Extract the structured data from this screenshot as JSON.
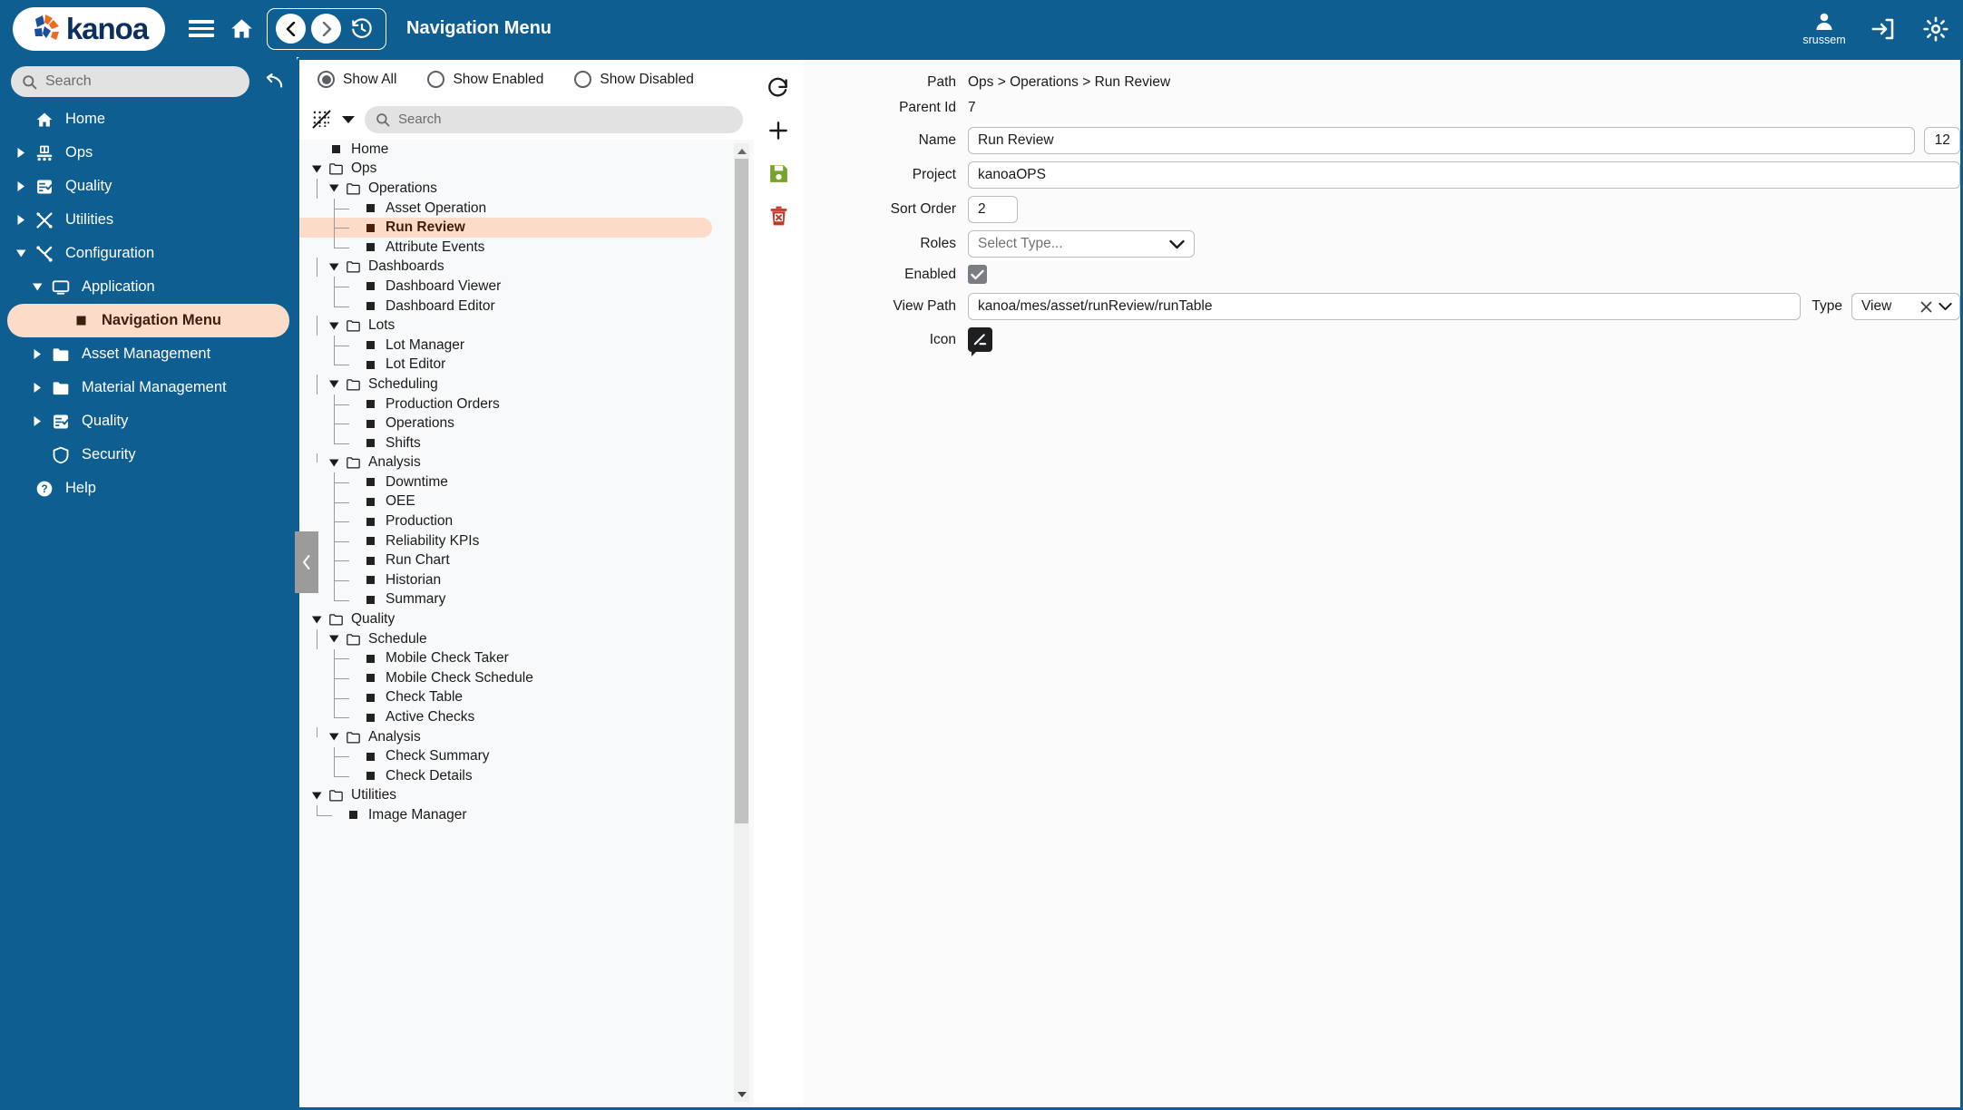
{
  "topbar": {
    "brand": "kanoa",
    "page_title": "Navigation Menu",
    "menu_icon": "hamburger-icon",
    "home_icon": "home-icon",
    "back_icon": "chevron-left-icon",
    "forward_icon": "chevron-right-icon",
    "history_icon": "history-clock-icon",
    "user_icon": "user-avatar-icon",
    "user_name": "srussem",
    "logout_icon": "logout-icon",
    "settings_icon": "gear-icon",
    "background_color": "#0e5e92"
  },
  "sidebar": {
    "search_placeholder": "Search",
    "search_icon": "search-icon",
    "undo_icon": "undo-arrow-icon",
    "items": [
      {
        "label": "Home",
        "icon": "home-icon",
        "caret": "none",
        "indent": 0,
        "selected": false
      },
      {
        "label": "Ops",
        "icon": "conveyor-icon",
        "caret": "right",
        "indent": 0,
        "selected": false
      },
      {
        "label": "Quality",
        "icon": "checklist-icon",
        "caret": "right",
        "indent": 0,
        "selected": false
      },
      {
        "label": "Utilities",
        "icon": "tools-icon",
        "caret": "right",
        "indent": 0,
        "selected": false
      },
      {
        "label": "Configuration",
        "icon": "wrench-icon",
        "caret": "down",
        "indent": 0,
        "selected": false
      },
      {
        "label": "Application",
        "icon": "monitor-icon",
        "caret": "down",
        "indent": 1,
        "selected": false
      },
      {
        "label": "Navigation Menu",
        "icon": "square-icon",
        "caret": "none",
        "indent": 2,
        "selected": true
      },
      {
        "label": "Asset Management",
        "icon": "folder-icon",
        "caret": "right",
        "indent": 1,
        "selected": false
      },
      {
        "label": "Material Management",
        "icon": "folder-icon",
        "caret": "right",
        "indent": 1,
        "selected": false
      },
      {
        "label": "Quality",
        "icon": "checklist-icon",
        "caret": "right",
        "indent": 1,
        "selected": false
      },
      {
        "label": "Security",
        "icon": "shield-icon",
        "caret": "none",
        "indent": 1,
        "selected": false
      },
      {
        "label": "Help",
        "icon": "help-circle-icon",
        "caret": "none",
        "indent": 0,
        "selected": false
      }
    ],
    "selected_bg": "#fcdcc8",
    "selected_fg": "#3d1f12"
  },
  "tree_panel": {
    "filters": [
      {
        "label": "Show All",
        "checked": true
      },
      {
        "label": "Show Enabled",
        "checked": false
      },
      {
        "label": "Show Disabled",
        "checked": false
      }
    ],
    "collapse_icon": "collapse-all-icon",
    "dropdown_icon": "chevron-down-icon",
    "search_placeholder": "Search",
    "search_icon": "search-icon",
    "collapse_handle_icon": "chevron-left-icon",
    "scroll_up_icon": "triangle-up-icon",
    "scroll_down_icon": "triangle-down-icon",
    "nodes": [
      {
        "label": "Home",
        "depth": 0,
        "type": "leaf",
        "caret": "none",
        "selected": false
      },
      {
        "label": "Ops",
        "depth": 0,
        "type": "folder",
        "caret": "down",
        "selected": false
      },
      {
        "label": "Operations",
        "depth": 1,
        "type": "folder",
        "caret": "down",
        "selected": false
      },
      {
        "label": "Asset Operation",
        "depth": 2,
        "type": "leaf",
        "caret": "none",
        "selected": false
      },
      {
        "label": "Run Review",
        "depth": 2,
        "type": "leaf",
        "caret": "none",
        "selected": true
      },
      {
        "label": "Attribute Events",
        "depth": 2,
        "type": "leaf",
        "caret": "none",
        "selected": false
      },
      {
        "label": "Dashboards",
        "depth": 1,
        "type": "folder",
        "caret": "down",
        "selected": false
      },
      {
        "label": "Dashboard Viewer",
        "depth": 2,
        "type": "leaf",
        "caret": "none",
        "selected": false
      },
      {
        "label": "Dashboard Editor",
        "depth": 2,
        "type": "leaf",
        "caret": "none",
        "selected": false
      },
      {
        "label": "Lots",
        "depth": 1,
        "type": "folder",
        "caret": "down",
        "selected": false
      },
      {
        "label": "Lot Manager",
        "depth": 2,
        "type": "leaf",
        "caret": "none",
        "selected": false
      },
      {
        "label": "Lot Editor",
        "depth": 2,
        "type": "leaf",
        "caret": "none",
        "selected": false
      },
      {
        "label": "Scheduling",
        "depth": 1,
        "type": "folder",
        "caret": "down",
        "selected": false
      },
      {
        "label": "Production Orders",
        "depth": 2,
        "type": "leaf",
        "caret": "none",
        "selected": false
      },
      {
        "label": "Operations",
        "depth": 2,
        "type": "leaf",
        "caret": "none",
        "selected": false
      },
      {
        "label": "Shifts",
        "depth": 2,
        "type": "leaf",
        "caret": "none",
        "selected": false
      },
      {
        "label": "Analysis",
        "depth": 1,
        "type": "folder",
        "caret": "down",
        "selected": false
      },
      {
        "label": "Downtime",
        "depth": 2,
        "type": "leaf",
        "caret": "none",
        "selected": false
      },
      {
        "label": "OEE",
        "depth": 2,
        "type": "leaf",
        "caret": "none",
        "selected": false
      },
      {
        "label": "Production",
        "depth": 2,
        "type": "leaf",
        "caret": "none",
        "selected": false
      },
      {
        "label": "Reliability KPIs",
        "depth": 2,
        "type": "leaf",
        "caret": "none",
        "selected": false
      },
      {
        "label": "Run Chart",
        "depth": 2,
        "type": "leaf",
        "caret": "none",
        "selected": false
      },
      {
        "label": "Historian",
        "depth": 2,
        "type": "leaf",
        "caret": "none",
        "selected": false
      },
      {
        "label": "Summary",
        "depth": 2,
        "type": "leaf",
        "caret": "none",
        "selected": false
      },
      {
        "label": "Quality",
        "depth": 0,
        "type": "folder",
        "caret": "down",
        "selected": false
      },
      {
        "label": "Schedule",
        "depth": 1,
        "type": "folder",
        "caret": "down",
        "selected": false
      },
      {
        "label": "Mobile Check Taker",
        "depth": 2,
        "type": "leaf",
        "caret": "none",
        "selected": false
      },
      {
        "label": "Mobile Check Schedule",
        "depth": 2,
        "type": "leaf",
        "caret": "none",
        "selected": false
      },
      {
        "label": "Check Table",
        "depth": 2,
        "type": "leaf",
        "caret": "none",
        "selected": false
      },
      {
        "label": "Active Checks",
        "depth": 2,
        "type": "leaf",
        "caret": "none",
        "selected": false
      },
      {
        "label": "Analysis",
        "depth": 1,
        "type": "folder",
        "caret": "down",
        "selected": false
      },
      {
        "label": "Check Summary",
        "depth": 2,
        "type": "leaf",
        "caret": "none",
        "selected": false
      },
      {
        "label": "Check Details",
        "depth": 2,
        "type": "leaf",
        "caret": "none",
        "selected": false
      },
      {
        "label": "Utilities",
        "depth": 0,
        "type": "folder",
        "caret": "down",
        "selected": false
      },
      {
        "label": "Image Manager",
        "depth": 1,
        "type": "leaf",
        "caret": "none",
        "selected": false
      }
    ]
  },
  "actions": [
    {
      "name": "refresh",
      "icon": "refresh-icon",
      "color": "#1b1b1b"
    },
    {
      "name": "add",
      "icon": "plus-icon",
      "color": "#1b1b1b"
    },
    {
      "name": "save",
      "icon": "save-disk-icon",
      "color": "#76a32b"
    },
    {
      "name": "delete",
      "icon": "trash-delete-icon",
      "color": "#c0392b"
    }
  ],
  "form": {
    "path_label": "Path",
    "path_value": "Ops > Operations > Run Review",
    "parent_id_label": "Parent Id",
    "parent_id_value": "7",
    "name_label": "Name",
    "name_value": "Run Review",
    "id_value": "12",
    "project_label": "Project",
    "project_value": "kanoaOPS",
    "sort_order_label": "Sort Order",
    "sort_order_value": "2",
    "roles_label": "Roles",
    "roles_placeholder": "Select Type...",
    "roles_chevron_icon": "chevron-down-icon",
    "enabled_label": "Enabled",
    "enabled_checked": true,
    "enabled_check_icon": "check-icon",
    "view_path_label": "View Path",
    "view_path_value": "kanoa/mes/asset/runReview/runTable",
    "type_label": "Type",
    "type_value": "View",
    "type_clear_icon": "close-x-icon",
    "type_chevron_icon": "chevron-down-icon",
    "icon_label": "Icon",
    "icon_value": "speech-bubble-edit-icon"
  }
}
